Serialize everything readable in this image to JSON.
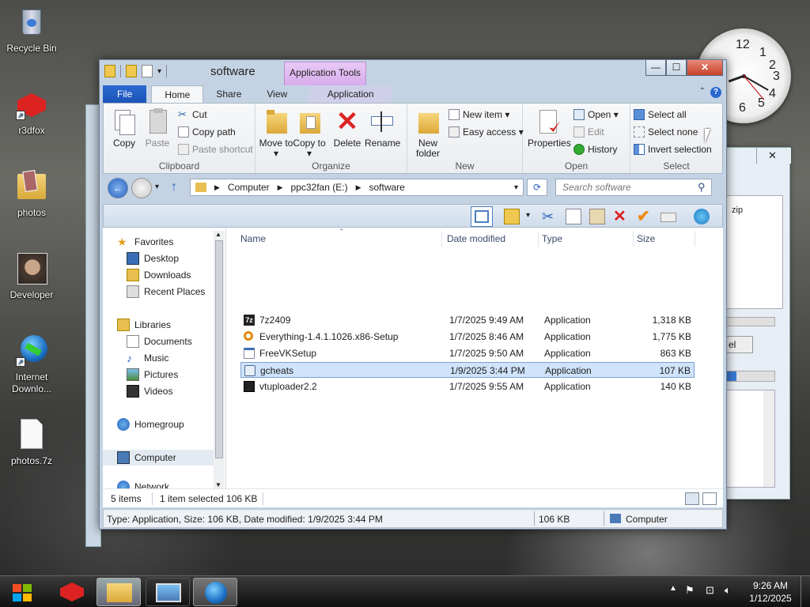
{
  "desktop": {
    "icons": [
      {
        "label": "Recycle Bin"
      },
      {
        "label": "r3dfox"
      },
      {
        "label": "photos"
      },
      {
        "label": "Developer"
      },
      {
        "label": "Internet Downlo..."
      },
      {
        "label": "photos.7z"
      }
    ],
    "clock_numbers": [
      "12",
      "1",
      "2",
      "3",
      "4",
      "5",
      "6"
    ]
  },
  "bg_window": {
    "zip_label": "zip",
    "button_label": "el"
  },
  "window": {
    "title": "software",
    "app_tools": "Application Tools",
    "controls": {
      "minimize": "—",
      "maximize": "☐",
      "close": "✕"
    },
    "tabs": [
      {
        "label": "File"
      },
      {
        "label": "Home"
      },
      {
        "label": "Share"
      },
      {
        "label": "View"
      },
      {
        "label": "Application"
      }
    ],
    "ribbon": {
      "clipboard": {
        "label": "Clipboard",
        "copy": "Copy",
        "paste": "Paste",
        "cut": "Cut",
        "copy_path": "Copy path",
        "paste_shortcut": "Paste shortcut"
      },
      "organize": {
        "label": "Organize",
        "move_to": "Move to ▾",
        "copy_to": "Copy to ▾",
        "delete": "Delete",
        "rename": "Rename"
      },
      "new": {
        "label": "New",
        "new_folder": "New folder",
        "new_item": "New item ▾",
        "easy_access": "Easy access ▾"
      },
      "open": {
        "label": "Open",
        "properties": "Properties",
        "open": "Open ▾",
        "edit": "Edit",
        "history": "History"
      },
      "select": {
        "label": "Select",
        "select_all": "Select all",
        "select_none": "Select none",
        "invert": "Invert selection"
      }
    },
    "address": {
      "crumbs": [
        "Computer",
        "ppc32fan (E:)",
        "software"
      ],
      "search_placeholder": "Search software"
    },
    "nav": {
      "favorites": "Favorites",
      "fav_items": [
        "Desktop",
        "Downloads",
        "Recent Places"
      ],
      "libraries": "Libraries",
      "lib_items": [
        "Documents",
        "Music",
        "Pictures",
        "Videos"
      ],
      "homegroup": "Homegroup",
      "computer": "Computer",
      "network": "Network"
    },
    "columns": {
      "name": "Name",
      "date": "Date modified",
      "type": "Type",
      "size": "Size"
    },
    "files": [
      {
        "name": "7z2409",
        "date": "1/7/2025 9:49 AM",
        "type": "Application",
        "size": "1,318 KB"
      },
      {
        "name": "Everything-1.4.1.1026.x86-Setup",
        "date": "1/7/2025 8:46 AM",
        "type": "Application",
        "size": "1,775 KB"
      },
      {
        "name": "FreeVKSetup",
        "date": "1/7/2025 9:50 AM",
        "type": "Application",
        "size": "863 KB"
      },
      {
        "name": "gcheats",
        "date": "1/9/2025 3:44 PM",
        "type": "Application",
        "size": "107 KB"
      },
      {
        "name": "vtuploader2.2",
        "date": "1/7/2025 9:55 AM",
        "type": "Application",
        "size": "140 KB"
      }
    ],
    "status": {
      "count": "5 items",
      "selected": "1 item selected 106 KB"
    },
    "statusbar": {
      "info": "Type: Application, Size: 106 KB, Date modified: 1/9/2025 3:44 PM",
      "size": "106 KB",
      "location": "Computer"
    }
  },
  "taskbar": {
    "time": "9:26 AM",
    "date": "1/12/2025"
  }
}
